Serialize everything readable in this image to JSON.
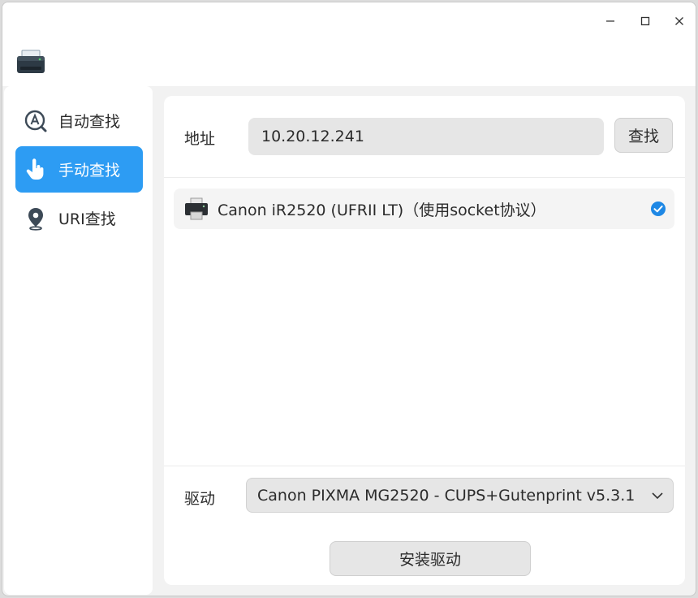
{
  "window": {
    "minimize_icon": "minimize-icon",
    "maximize_icon": "maximize-icon",
    "close_icon": "close-icon",
    "app_icon": "printer-app-icon"
  },
  "sidebar": {
    "items": [
      {
        "label": "自动查找",
        "icon": "auto-search-icon",
        "active": false
      },
      {
        "label": "手动查找",
        "icon": "hand-pointer-icon",
        "active": true
      },
      {
        "label": "URI查找",
        "icon": "location-pin-icon",
        "active": false
      }
    ]
  },
  "main": {
    "address_label": "地址",
    "address_value": "10.20.12.241",
    "find_button": "查找",
    "results": [
      {
        "name": "Canon iR2520 (UFRII LT)（使用socket协议）",
        "selected": true
      }
    ],
    "driver_label": "驱动",
    "driver_value": "Canon PIXMA MG2520 - CUPS+Gutenprint v5.3.1",
    "install_button": "安装驱动"
  },
  "colors": {
    "accent": "#2d9cf3",
    "check": "#1e88e5"
  }
}
